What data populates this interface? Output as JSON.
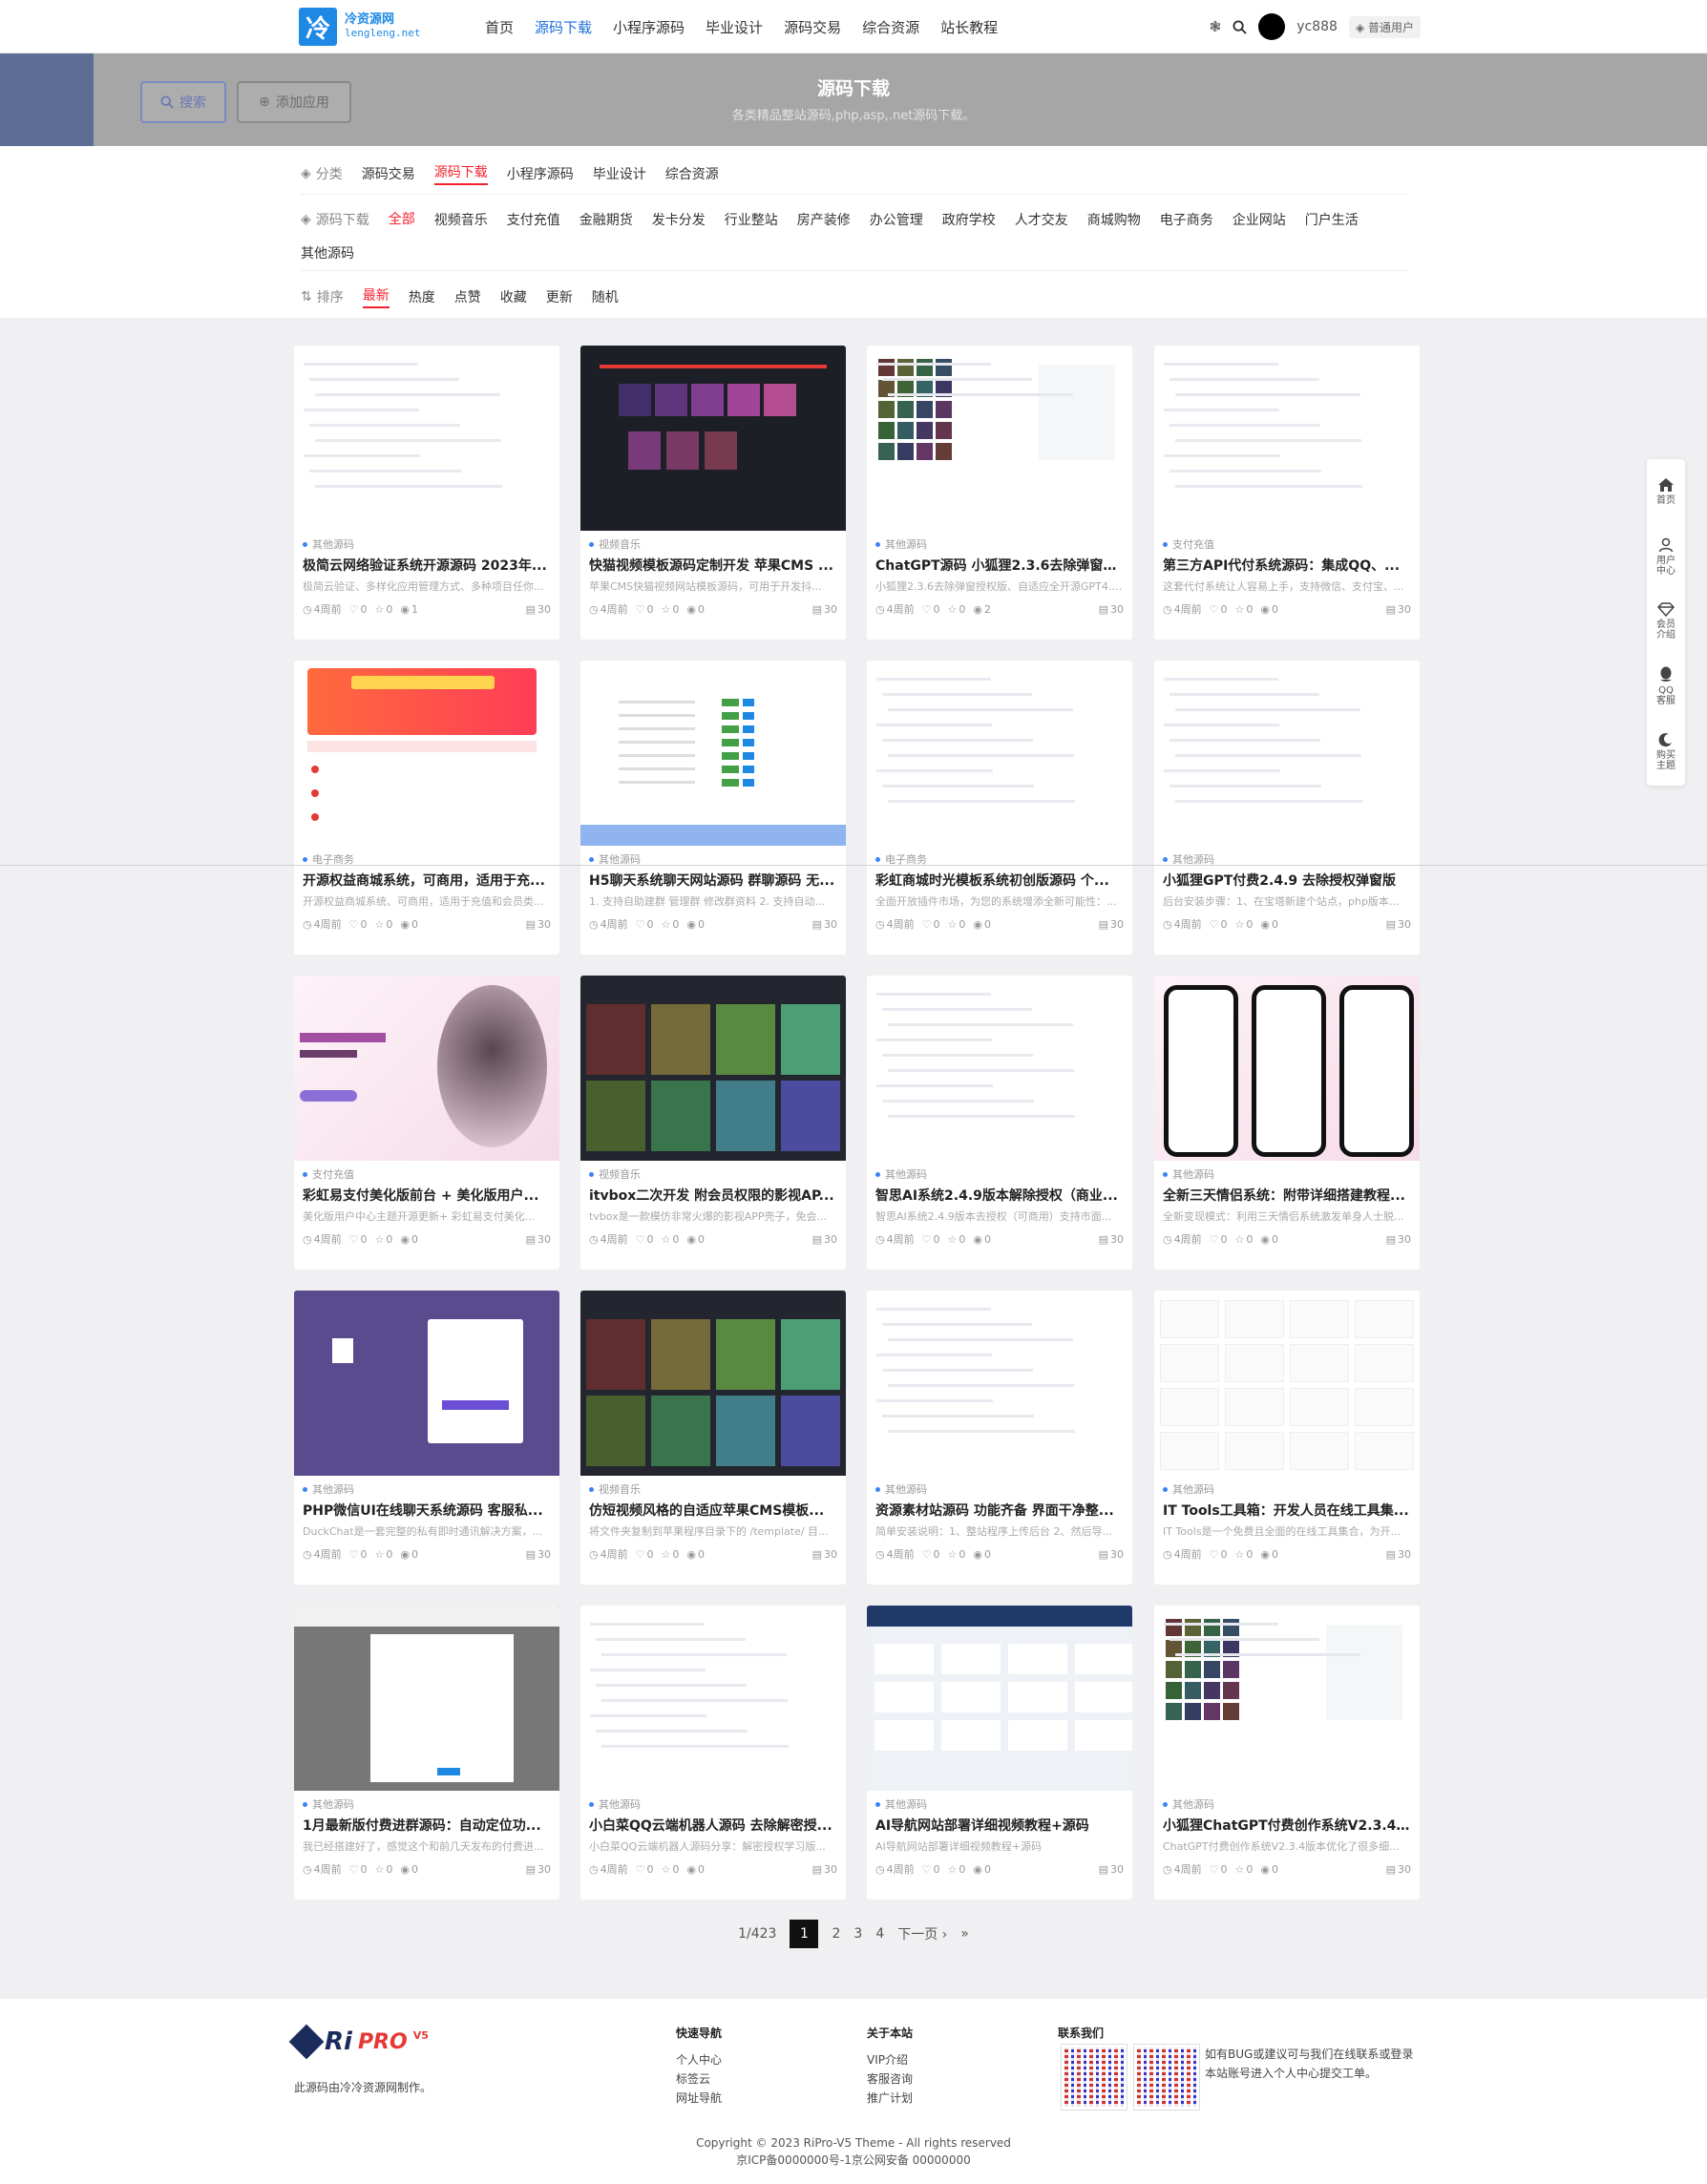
{
  "header": {
    "logo_mark": "冷",
    "logo_name": "冷资源网",
    "logo_domain": "lengleng.net",
    "nav": [
      {
        "label": "首页",
        "active": false
      },
      {
        "label": "源码下载",
        "active": true
      },
      {
        "label": "小程序源码",
        "active": false
      },
      {
        "label": "毕业设计",
        "active": false
      },
      {
        "label": "源码交易",
        "active": false
      },
      {
        "label": "综合资源",
        "active": false
      },
      {
        "label": "站长教程",
        "active": false
      }
    ],
    "username": "yc888",
    "user_badge": "普通用户"
  },
  "banner": {
    "title": "源码下载",
    "subtitle": "各类精品整站源码,php,asp,.net源码下载。",
    "search_label": "搜索",
    "add_label": "添加应用"
  },
  "filters": {
    "category_label": "分类",
    "categories": [
      "源码交易",
      "源码下载",
      "小程序源码",
      "毕业设计",
      "综合资源"
    ],
    "active_category": "源码下载",
    "sub_label": "源码下载",
    "subs": [
      "全部",
      "视频音乐",
      "支付充值",
      "金融期货",
      "发卡分发",
      "行业整站",
      "房产装修",
      "办公管理",
      "政府学校",
      "人才交友",
      "商城购物",
      "电子商务",
      "企业网站",
      "门户生活",
      "其他源码"
    ],
    "active_sub": "全部",
    "sort_label": "排序",
    "sorts": [
      "最新",
      "热度",
      "点赞",
      "收藏",
      "更新",
      "随机"
    ],
    "active_sort": "最新"
  },
  "cards": [
    {
      "cat": "其他源码",
      "title": "极简云网络验证系统开源源码 2023年...",
      "desc": "极简云验证、多样化应用管理方式、多种项目任你...",
      "time": "4周前",
      "likes": "0",
      "favs": "0",
      "views": "1",
      "count": "30",
      "thumb": "white"
    },
    {
      "cat": "视频音乐",
      "title": "快猫视频模板源码定制开发 苹果CMS ...",
      "desc": "苹果CMS快猫视频网站模板源码，可用于开发抖...",
      "time": "4周前",
      "likes": "0",
      "favs": "0",
      "views": "0",
      "count": "30",
      "thumb": "dark"
    },
    {
      "cat": "其他源码",
      "title": "ChatGPT源码 小狐狸2.3.6去除弹窗授...",
      "desc": "小狐狸2.3.6去除弹窗授权版、自适应全开源GPT4.0...",
      "time": "4周前",
      "likes": "0",
      "favs": "0",
      "views": "2",
      "count": "30",
      "thumb": "chat"
    },
    {
      "cat": "支付充值",
      "title": "第三方API代付系统源码：集成QQ、...",
      "desc": "这套代付系统让人容易上手，支持微信、支付宝、...",
      "time": "4周前",
      "likes": "0",
      "favs": "0",
      "views": "0",
      "count": "30",
      "thumb": "white"
    },
    {
      "cat": "电子商务",
      "title": "开源权益商城系统，可商用，适用于充...",
      "desc": "开源权益商城系统、可商用，适用于充值和会员类...",
      "time": "4周前",
      "likes": "0",
      "favs": "0",
      "views": "0",
      "count": "30",
      "thumb": "shop"
    },
    {
      "cat": "其他源码",
      "title": "H5聊天系统聊天网站源码 群聊源码 无...",
      "desc": "1. 支持自助建群 管理群 修改群资料 2. 支持自动...",
      "time": "4周前",
      "likes": "0",
      "favs": "0",
      "views": "0",
      "count": "30",
      "thumb": "table"
    },
    {
      "cat": "电子商务",
      "title": "彩虹商城时光模板系统初创版源码 个...",
      "desc": "全面开放插件市场，为您的系统增添全新可能性：...",
      "time": "4周前",
      "likes": "0",
      "favs": "0",
      "views": "0",
      "count": "30",
      "thumb": "white"
    },
    {
      "cat": "其他源码",
      "title": "小狐狸GPT付费2.4.9 去除授权弹窗版",
      "desc": "后台安装步骤：1、在宝塔新建个站点，php版本...",
      "time": "4周前",
      "likes": "0",
      "favs": "0",
      "views": "0",
      "count": "30",
      "thumb": "white"
    },
    {
      "cat": "支付充值",
      "title": "彩虹易支付美化版前台 + 美化版用户...",
      "desc": "美化版用户中心主题开源更新+ 彩虹易支付美化...",
      "time": "4周前",
      "likes": "0",
      "favs": "0",
      "views": "0",
      "count": "30",
      "thumb": "pay"
    },
    {
      "cat": "视频音乐",
      "title": "itvbox二次开发 附会员权限的影视AP...",
      "desc": "tvbox是一款模仿非常火爆的影视APP壳子，免会...",
      "time": "4周前",
      "likes": "0",
      "favs": "0",
      "views": "0",
      "count": "30",
      "thumb": "movie"
    },
    {
      "cat": "其他源码",
      "title": "智思AI系统2.4.9版本解除授权（商业...",
      "desc": "智思AI系统2.4.9版本去授权（可商用）支持市面...",
      "time": "4周前",
      "likes": "0",
      "favs": "0",
      "views": "0",
      "count": "30",
      "thumb": "white"
    },
    {
      "cat": "其他源码",
      "title": "全新三天情侣系统：附带详细搭建教程...",
      "desc": "全新变现模式：利用三天情侣系统激发单身人士脱...",
      "time": "4周前",
      "likes": "0",
      "favs": "0",
      "views": "0",
      "count": "30",
      "thumb": "phone"
    },
    {
      "cat": "其他源码",
      "title": "PHP微信UI在线聊天系统源码 客服私...",
      "desc": "DuckChat是一套完整的私有即时通讯解决方案，...",
      "time": "4周前",
      "likes": "0",
      "favs": "0",
      "views": "0",
      "count": "30",
      "thumb": "purple"
    },
    {
      "cat": "视频音乐",
      "title": "仿短视频风格的自适应苹果CMS模板...",
      "desc": "将文件夹复制到苹果程序目录下的 /template/ 目...",
      "time": "4周前",
      "likes": "0",
      "favs": "0",
      "views": "0",
      "count": "30",
      "thumb": "movie2"
    },
    {
      "cat": "其他源码",
      "title": "资源素材站源码 功能齐备 界面干净整...",
      "desc": "简单安装说明：1、整站程序上传后台 2、然后导...",
      "time": "4周前",
      "likes": "0",
      "favs": "0",
      "views": "0",
      "count": "30",
      "thumb": "white"
    },
    {
      "cat": "其他源码",
      "title": "IT Tools工具箱：开发人员在线工具集...",
      "desc": "IT Tools是一个免费且全面的在线工具集合，为开...",
      "time": "4周前",
      "likes": "0",
      "favs": "0",
      "views": "0",
      "count": "30",
      "thumb": "grid"
    },
    {
      "cat": "其他源码",
      "title": "1月最新版付费进群源码：自动定位功...",
      "desc": "我已经搭建好了，感觉这个和前几天发布的付费进...",
      "time": "4周前",
      "likes": "0",
      "favs": "0",
      "views": "0",
      "count": "30",
      "thumb": "gray"
    },
    {
      "cat": "其他源码",
      "title": "小白菜QQ云端机器人源码 去除解密授...",
      "desc": "小白菜QQ云端机器人源码分享：解密授权学习版...",
      "time": "4周前",
      "likes": "0",
      "favs": "0",
      "views": "0",
      "count": "30",
      "thumb": "white"
    },
    {
      "cat": "其他源码",
      "title": "AI导航网站部署详细视频教程+源码",
      "desc": "AI导航网站部署详细视频教程+源码",
      "time": "4周前",
      "likes": "0",
      "favs": "0",
      "views": "0",
      "count": "30",
      "thumb": "ainav"
    },
    {
      "cat": "其他源码",
      "title": "小狐狸ChatGPT付费创作系统V2.3.4...",
      "desc": "ChatGPT付费创作系统V2.3.4版本优化了很多细...",
      "time": "4周前",
      "likes": "0",
      "favs": "0",
      "views": "0",
      "count": "30",
      "thumb": "chat2"
    }
  ],
  "pagination": {
    "info": "1/423",
    "current": "1",
    "pages": [
      "2",
      "3",
      "4"
    ],
    "next": "下一页",
    "last": "»"
  },
  "sidebar": [
    "首页",
    "用户中心",
    "会员介绍",
    "QQ客服",
    "购买主题"
  ],
  "footer": {
    "logo_ri": "Ri",
    "logo_pro": "PRO",
    "logo_v": "V5",
    "desc": "此源码由冷冷资源网制作。",
    "col1_title": "快速导航",
    "col1": [
      "个人中心",
      "标签云",
      "网址导航"
    ],
    "col2_title": "关于本站",
    "col2": [
      "VIP介绍",
      "客服咨询",
      "推广计划"
    ],
    "col3_title": "联系我们",
    "note": "如有BUG或建议可与我们在线联系或登录本站账号进入个人中心提交工单。",
    "copyright": "Copyright © 2023 RiPro-V5 Theme - All rights reserved",
    "icp": "京ICP备0000000号-1京公网安备 00000000"
  }
}
